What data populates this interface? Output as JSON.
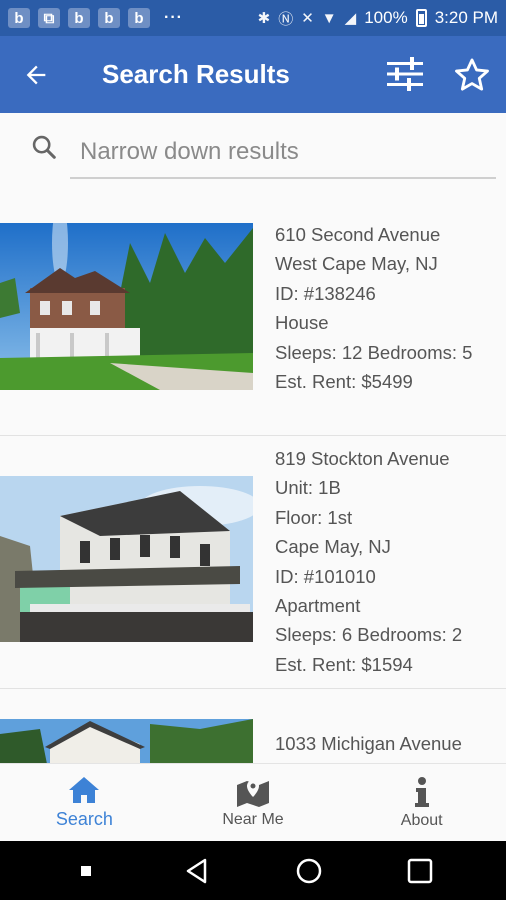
{
  "status_bar": {
    "notification_icons": [
      "b",
      "b",
      "b",
      "b",
      "b"
    ],
    "overflow": "···",
    "battery": "100%",
    "time": "3:20 PM"
  },
  "app_bar": {
    "title": "Search Results",
    "back_icon": "arrow-back-icon",
    "filter_icon": "filter-sliders-icon",
    "favorite_icon": "star-outline-icon"
  },
  "search": {
    "placeholder": "Narrow down results",
    "value": ""
  },
  "results": [
    {
      "lines": [
        "610 Second Avenue",
        "West Cape May, NJ",
        "ID: #138246",
        "House",
        "Sleeps: 12  Bedrooms: 5",
        "Est. Rent: $5499"
      ]
    },
    {
      "lines": [
        "819 Stockton Avenue",
        "Unit: 1B",
        "Floor: 1st",
        "Cape May, NJ",
        "ID: #101010",
        "Apartment",
        "Sleeps: 6  Bedrooms: 2",
        "Est. Rent: $1594"
      ]
    },
    {
      "lines": [
        "1033 Michigan Avenue"
      ]
    }
  ],
  "bottom_nav": [
    {
      "label": "Search",
      "icon": "home-icon",
      "active": true
    },
    {
      "label": "Near Me",
      "icon": "map-pin-icon",
      "active": false
    },
    {
      "label": "About",
      "icon": "info-icon",
      "active": false
    }
  ],
  "colors": {
    "status_bar": "#2b5ca7",
    "app_bar": "#3a6bbf",
    "accent": "#3d82d6"
  }
}
